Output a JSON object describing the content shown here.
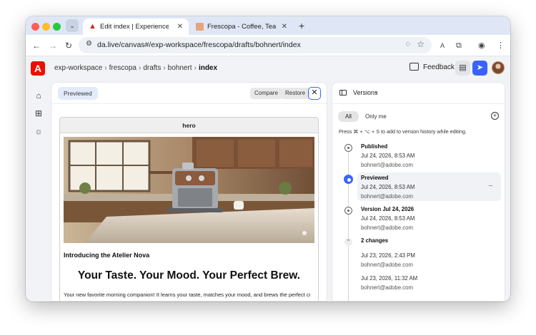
{
  "browser": {
    "tabs": [
      {
        "title": "Edit index | Experience Workspace",
        "icon": "adobe-icon",
        "active": true
      },
      {
        "title": "Frescopa - Coffee, Tea & Accessories",
        "icon": "frescopa-favicon",
        "active": false
      }
    ],
    "url": "da.live/canvas#/exp-workspace/frescopa/drafts/bohnert/index",
    "extension_badge": "A",
    "traffic_lights": {
      "red": "#ff5f57",
      "yellow": "#febc2e",
      "green": "#28c840"
    }
  },
  "app": {
    "logo_letter": "A",
    "breadcrumbs": [
      "exp-workspace",
      "frescopa",
      "drafts",
      "bohnert"
    ],
    "breadcrumb_current": "index",
    "feedback_label": "Feedback",
    "brand_color": "#eb1000",
    "accent_color": "#3b63fb",
    "rail_icons": [
      "home-icon",
      "blocks-icon",
      "lightbulb-icon"
    ]
  },
  "editor": {
    "status_pill": "Previewed",
    "compare_label": "Compare",
    "restore_label": "Restore",
    "block_label": "hero",
    "intro_text": "Introducing the Atelier Nova",
    "headline": "Your Taste. Your Mood. Your Perfect Brew.",
    "body_text": "Your new favorite morning companion! It learns your taste, matches your mood, and brews the perfect cup —"
  },
  "versions": {
    "title": "Versions",
    "filter_all": "All",
    "filter_mine": "Only me",
    "hint": "Press ⌘ + ⌥ + S to add to version history while editing.",
    "entries": [
      {
        "name": "Published",
        "date": "Jul 24, 2026, 8:53 AM",
        "user": "bohnert@adobe.com"
      },
      {
        "name": "Previewed",
        "date": "Jul 24, 2026, 8:53 AM",
        "user": "bohnert@adobe.com",
        "more": "···"
      },
      {
        "name": "Version Jul 24, 2026",
        "date": "Jul 24, 2026, 8:53 AM",
        "user": "bohnert@adobe.com"
      }
    ],
    "changes_group": {
      "label": "2 changes",
      "items": [
        {
          "date": "Jul 23, 2026, 2:43 PM",
          "user": "bohnert@adobe.com"
        },
        {
          "date": "Jul 23, 2026, 11:32 AM",
          "user": "bohnert@adobe.com"
        }
      ]
    }
  }
}
